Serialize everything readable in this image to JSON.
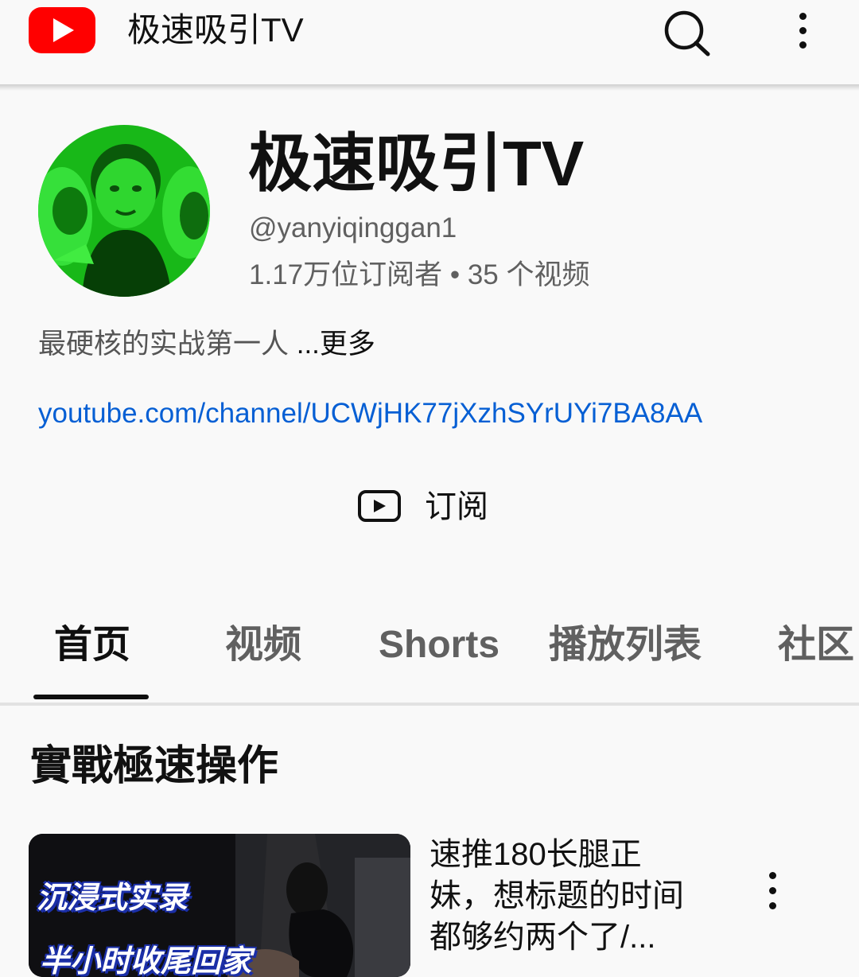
{
  "topbar": {
    "logo_icon": "youtube-logo-icon",
    "title": "极速吸引TV",
    "search_icon": "search-icon",
    "more_icon": "more-vertical-icon"
  },
  "channel": {
    "name": "极速吸引TV",
    "handle": "@yanyiqinggan1",
    "stats": "1.17万位订阅者 • 35 个视频",
    "description": "最硬核的实战第一人 ",
    "more_label": "...更多",
    "link": "youtube.com/channel/UCWjHK77jXzhSYrUYi7BA8AA",
    "avatar_tint": "#1fcf1f"
  },
  "subscribe": {
    "label": "订阅",
    "icon": "play-icon"
  },
  "tabs": [
    {
      "label": "首页",
      "active": true
    },
    {
      "label": "视频",
      "active": false
    },
    {
      "label": "Shorts",
      "active": false
    },
    {
      "label": "播放列表",
      "active": false
    },
    {
      "label": "社区",
      "active": false
    }
  ],
  "section": {
    "title": "實戰極速操作"
  },
  "videos": [
    {
      "thumbnail_text": [
        "沉浸式实录",
        "半小时收尾回家"
      ],
      "title_lines": [
        "速推180长腿正",
        "妹，想标题的时间",
        "都够约两个了/..."
      ],
      "more_icon": "more-vertical-icon"
    }
  ],
  "colors": {
    "brand_red": "#ff0000",
    "link_blue": "#065fd4",
    "background": "#f9f9f9"
  }
}
